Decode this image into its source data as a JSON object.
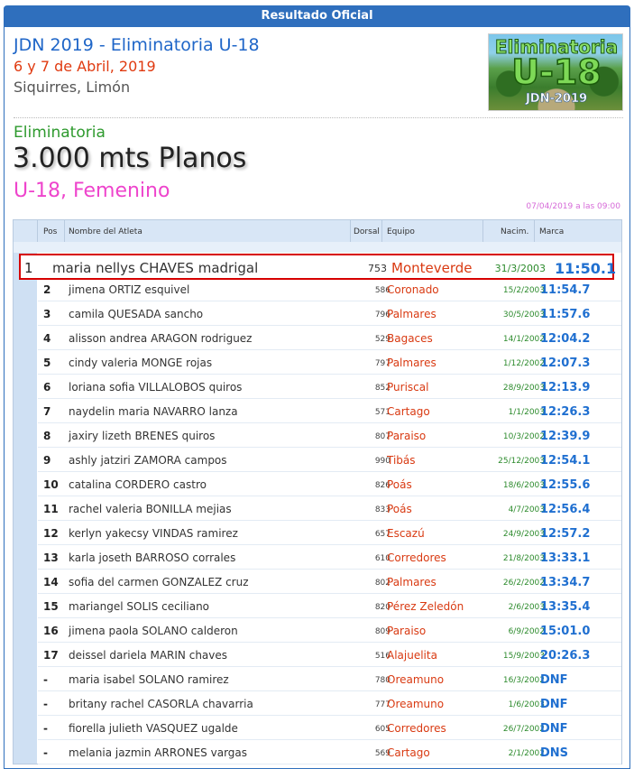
{
  "header": {
    "title": "Resultado Oficial"
  },
  "event": {
    "title": "JDN 2019 - Eliminatoria U-18",
    "dates": "6 y 7 de Abril, 2019",
    "location": "Siquirres, Limón"
  },
  "logo": {
    "line1": "Eliminatoria",
    "line2": "U-18",
    "line3": "JDN-2019"
  },
  "race": {
    "phase": "Eliminatoria",
    "discipline": "3.000 mts Planos",
    "category": "U-18, Femenino",
    "datetime": "07/04/2019 a las 09:00"
  },
  "columns": {
    "pos": "Pos",
    "name": "Nombre del Atleta",
    "bib": "Dorsal",
    "team": "Equipo",
    "dob": "Nacim.",
    "mark": "Marca"
  },
  "winner": {
    "pos": "1",
    "name": "maria nellys CHAVES madrigal",
    "bib": "753",
    "team": "Monteverde",
    "dob": "31/3/2003",
    "mark": "11:50.1"
  },
  "results": [
    {
      "pos": "2",
      "name": "jimena ORTIZ esquivel",
      "bib": "586",
      "team": "Coronado",
      "dob": "15/2/2003",
      "mark": "11:54.7"
    },
    {
      "pos": "3",
      "name": "camila QUESADA sancho",
      "bib": "796",
      "team": "Palmares",
      "dob": "30/5/2003",
      "mark": "11:57.6"
    },
    {
      "pos": "4",
      "name": "alisson andrea ARAGON rodriguez",
      "bib": "529",
      "team": "Bagaces",
      "dob": "14/1/2002",
      "mark": "12:04.2"
    },
    {
      "pos": "5",
      "name": "cindy valeria MONGE rojas",
      "bib": "797",
      "team": "Palmares",
      "dob": "1/12/2002",
      "mark": "12:07.3"
    },
    {
      "pos": "6",
      "name": "loriana sofia VILLALOBOS quiros",
      "bib": "852",
      "team": "Puriscal",
      "dob": "28/9/2003",
      "mark": "12:13.9"
    },
    {
      "pos": "7",
      "name": "naydelin maria NAVARRO lanza",
      "bib": "571",
      "team": "Cartago",
      "dob": "1/1/2003",
      "mark": "12:26.3"
    },
    {
      "pos": "8",
      "name": "jaxiry lizeth BRENES quiros",
      "bib": "807",
      "team": "Paraiso",
      "dob": "10/3/2002",
      "mark": "12:39.9"
    },
    {
      "pos": "9",
      "name": "ashly jatziri ZAMORA campos",
      "bib": "990",
      "team": "Tibás",
      "dob": "25/12/2003",
      "mark": "12:54.1"
    },
    {
      "pos": "10",
      "name": "catalina CORDERO castro",
      "bib": "826",
      "team": "Poás",
      "dob": "18/6/2003",
      "mark": "12:55.6"
    },
    {
      "pos": "11",
      "name": "rachel valeria BONILLA mejias",
      "bib": "833",
      "team": "Poás",
      "dob": "4/7/2003",
      "mark": "12:56.4"
    },
    {
      "pos": "12",
      "name": "kerlyn yakecsy VINDAS ramirez",
      "bib": "657",
      "team": "Escazú",
      "dob": "24/9/2003",
      "mark": "12:57.2"
    },
    {
      "pos": "13",
      "name": "karla joseth BARROSO corrales",
      "bib": "610",
      "team": "Corredores",
      "dob": "21/8/2003",
      "mark": "13:33.1"
    },
    {
      "pos": "14",
      "name": "sofia del carmen GONZALEZ cruz",
      "bib": "802",
      "team": "Palmares",
      "dob": "26/2/2002",
      "mark": "13:34.7"
    },
    {
      "pos": "15",
      "name": "mariangel SOLIS ceciliano",
      "bib": "820",
      "team": "Pérez Zeledón",
      "dob": "2/6/2003",
      "mark": "13:35.4"
    },
    {
      "pos": "16",
      "name": "jimena paola SOLANO calderon",
      "bib": "809",
      "team": "Paraiso",
      "dob": "6/9/2002",
      "mark": "15:01.0"
    },
    {
      "pos": "17",
      "name": "deissel dariela MARIN chaves",
      "bib": "516",
      "team": "Alajuelita",
      "dob": "15/9/2003",
      "mark": "20:26.3"
    },
    {
      "pos": "-",
      "name": "maria isabel SOLANO ramirez",
      "bib": "780",
      "team": "Oreamuno",
      "dob": "16/3/2002",
      "mark": "DNF"
    },
    {
      "pos": "-",
      "name": "britany rachel CASORLA chavarria",
      "bib": "777",
      "team": "Oreamuno",
      "dob": "1/6/2003",
      "mark": "DNF"
    },
    {
      "pos": "-",
      "name": "fiorella julieth VASQUEZ ugalde",
      "bib": "605",
      "team": "Corredores",
      "dob": "26/7/2002",
      "mark": "DNF"
    },
    {
      "pos": "-",
      "name": "melania jazmin ARRONES vargas",
      "bib": "569",
      "team": "Cartago",
      "dob": "2/1/2002",
      "mark": "DNS"
    }
  ]
}
